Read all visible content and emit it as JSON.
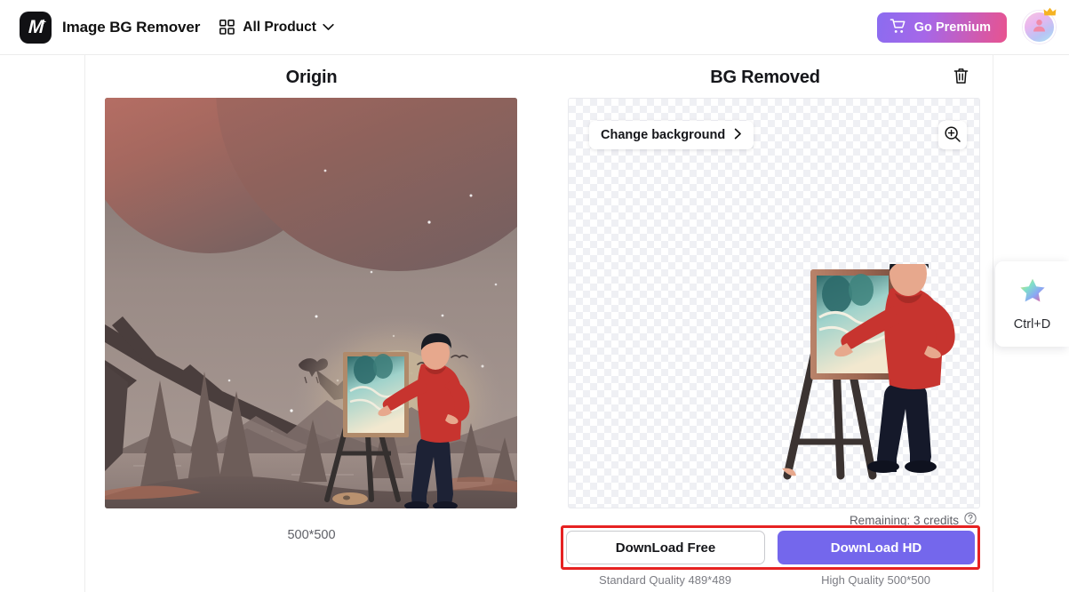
{
  "header": {
    "logo_letter": "M",
    "logo_plus": "+",
    "app_title": "Image BG Remover",
    "all_product_label": "All Product",
    "grid_icon": "grid-icon",
    "chevron_icon": "chevron-down-icon",
    "premium_label": "Go Premium",
    "cart_icon": "cart-icon",
    "avatar_icon": "user-avatar-icon",
    "crown_icon": "crown-icon"
  },
  "origin": {
    "title": "Origin",
    "caption": "500*500"
  },
  "result": {
    "title": "BG Removed",
    "delete_icon": "trash-icon",
    "change_background_label": "Change background",
    "change_background_chevron": "chevron-right-icon",
    "zoom_icon": "zoom-in-icon",
    "credits_text": "Remaining: 3 credits",
    "help_icon": "question-circle-icon",
    "download_free_label": "DownLoad Free",
    "download_hd_label": "DownLoad HD",
    "download_free_sub": "Standard Quality 489*489",
    "download_hd_sub": "High Quality 500*500"
  },
  "bookmark_widget": {
    "star_icon": "star-icon",
    "shortcut_label": "Ctrl+D"
  },
  "colors": {
    "premium_gradient_start": "#8b6cf0",
    "premium_gradient_end": "#e8538f",
    "download_hd": "#7467ec",
    "highlight_red": "#e62222",
    "text_primary": "#15161a",
    "text_muted": "#5f6067"
  }
}
